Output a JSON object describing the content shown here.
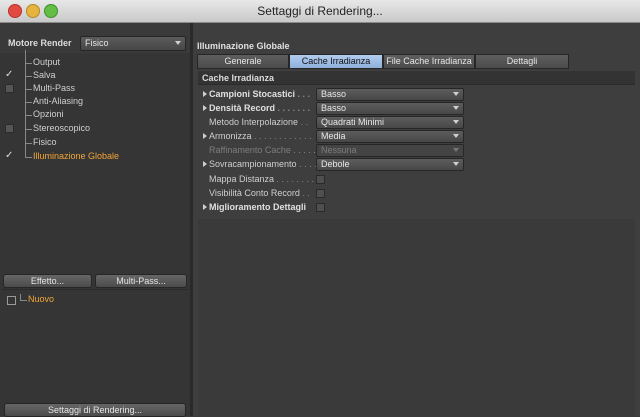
{
  "window": {
    "title": "Settaggi di Rendering..."
  },
  "left": {
    "engine_label": "Motore Render",
    "engine_value": "Fisico",
    "items": [
      {
        "label": "Output",
        "check": "none",
        "active": false
      },
      {
        "label": "Salva",
        "check": "checked",
        "active": false
      },
      {
        "label": "Multi-Pass",
        "check": "box",
        "active": false
      },
      {
        "label": "Anti-Aliasing",
        "check": "none",
        "active": false
      },
      {
        "label": "Opzioni",
        "check": "none",
        "active": false
      },
      {
        "label": "Stereoscopico",
        "check": "box",
        "active": false
      },
      {
        "label": "Fisico",
        "check": "none",
        "active": false
      },
      {
        "label": "Illuminazione Globale",
        "check": "checked",
        "active": true
      }
    ],
    "effect_button": "Effetto...",
    "multipass_button": "Multi-Pass...",
    "preset_item": "Nuovo",
    "bottom_button": "Settaggi di Rendering..."
  },
  "right": {
    "panel_title": "Illuminazione Globale",
    "tabs": [
      {
        "label": "Generale",
        "selected": false
      },
      {
        "label": "Cache Irradianza",
        "selected": true
      },
      {
        "label": "File Cache Irradianza",
        "selected": false
      },
      {
        "label": "Dettagli",
        "selected": false
      }
    ],
    "section_title": "Cache Irradianza",
    "rows": [
      {
        "label": "Campioni Stocastici",
        "dots": " . . .",
        "value": "Basso",
        "bold": true,
        "triangle": true,
        "dim": false,
        "kind": "select"
      },
      {
        "label": "Densità Record",
        "dots": " . . . . . . .",
        "value": "Basso",
        "bold": true,
        "triangle": true,
        "dim": false,
        "kind": "select"
      },
      {
        "label": "Metodo Interpolazione",
        "dots": " . .",
        "value": "Quadrati Minimi",
        "bold": false,
        "triangle": false,
        "dim": false,
        "kind": "select"
      },
      {
        "label": "Armonizza",
        "dots": " . . . . . . . . . . . .",
        "value": "Media",
        "bold": false,
        "triangle": true,
        "dim": false,
        "kind": "select"
      },
      {
        "label": "Raffinamento Cache",
        "dots": " . . . . .",
        "value": "Nessuna",
        "bold": false,
        "triangle": false,
        "dim": true,
        "kind": "select"
      },
      {
        "label": "Sovracampionamento",
        "dots": " . . . .",
        "value": "Debole",
        "bold": false,
        "triangle": true,
        "dim": false,
        "kind": "select"
      },
      {
        "label": "Mappa Distanza",
        "dots": " . . . . . . . .",
        "value": "",
        "bold": false,
        "triangle": false,
        "dim": false,
        "kind": "check"
      },
      {
        "label": "Visibilità Conto Record",
        "dots": " . .",
        "value": "",
        "bold": false,
        "triangle": false,
        "dim": false,
        "kind": "check"
      },
      {
        "label": "Miglioramento Dettagli",
        "dots": "",
        "value": "",
        "bold": true,
        "triangle": true,
        "dim": false,
        "kind": "check"
      }
    ]
  }
}
